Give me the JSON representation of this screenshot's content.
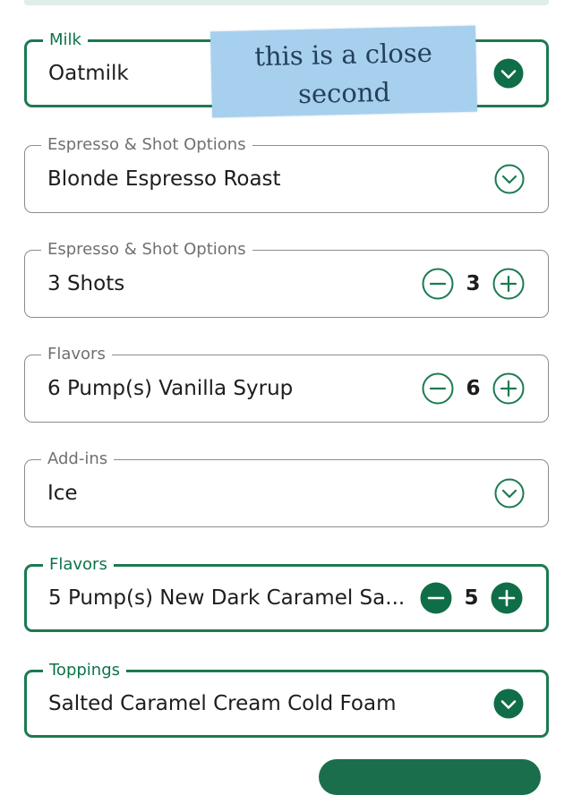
{
  "fields": [
    {
      "legend": "Milk",
      "value": "Oatmilk",
      "control": "dropdown",
      "icon": "chevron-down-filled-icon"
    },
    {
      "legend": "Espresso & Shot Options",
      "value": "Blonde Espresso Roast",
      "control": "dropdown",
      "icon": "chevron-down-outline-icon"
    },
    {
      "legend": "Espresso & Shot Options",
      "value": "3 Shots",
      "control": "stepper",
      "count": "3"
    },
    {
      "legend": "Flavors",
      "value": "6 Pump(s) Vanilla Syrup",
      "control": "stepper",
      "count": "6"
    },
    {
      "legend": "Add-ins",
      "value": "Ice",
      "control": "dropdown",
      "icon": "chevron-down-outline-icon"
    },
    {
      "legend": "Flavors",
      "value": "5 Pump(s) New Dark Caramel Sa...",
      "control": "stepper",
      "count": "5"
    },
    {
      "legend": "Toppings",
      "value": "Salted Caramel Cream Cold Foam",
      "control": "dropdown",
      "icon": "chevron-down-filled-icon"
    }
  ],
  "annotation": {
    "line1": "this is a close",
    "line2": "second"
  },
  "colors": {
    "accent": "#1b7a50",
    "accent_fill": "#0f6e47",
    "border_gray": "#8c8c8c",
    "tape": "#a7d0ee"
  }
}
